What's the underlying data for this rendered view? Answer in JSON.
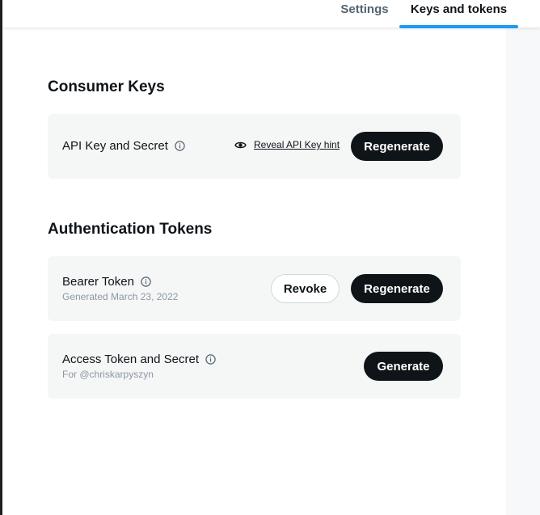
{
  "tabs": {
    "settings": "Settings",
    "keys_and_tokens": "Keys and tokens"
  },
  "consumer_keys": {
    "title": "Consumer Keys",
    "api_key": {
      "label": "API Key and Secret",
      "reveal_link": "Reveal API Key hint",
      "regenerate_button": "Regenerate"
    }
  },
  "authentication_tokens": {
    "title": "Authentication Tokens",
    "bearer": {
      "label": "Bearer Token",
      "subtext": "Generated March 23, 2022",
      "revoke_button": "Revoke",
      "regenerate_button": "Regenerate"
    },
    "access": {
      "label": "Access Token and Secret",
      "subtext": "For @chriskarpyszyn",
      "generate_button": "Generate"
    }
  },
  "colors": {
    "accent": "#1d9bf0",
    "button_dark": "#0f1419",
    "card_bg": "#f5f6f6"
  },
  "icons": [
    "info-icon",
    "eye-icon"
  ]
}
